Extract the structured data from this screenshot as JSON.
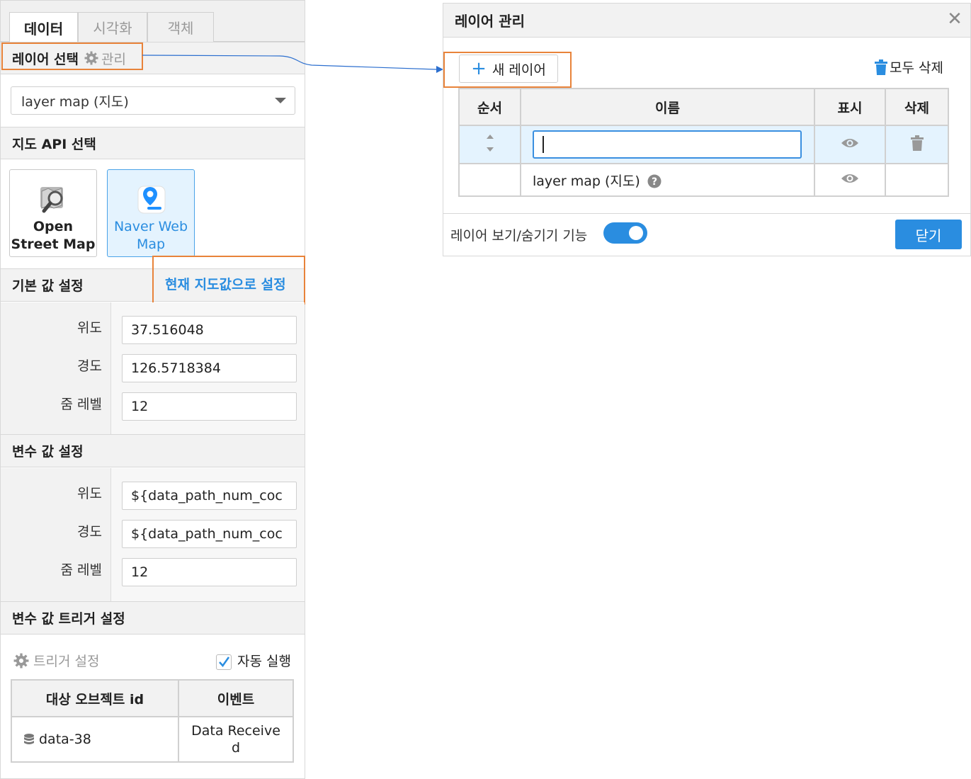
{
  "tabs": [
    {
      "label": "데이터",
      "active": true
    },
    {
      "label": "시각화",
      "active": false
    },
    {
      "label": "객체",
      "active": false
    }
  ],
  "layer_select": {
    "title": "레이어 선택",
    "manage_label": "관리",
    "selected_value": "layer map (지도)"
  },
  "map_api": {
    "title": "지도 API 선택",
    "options": [
      {
        "label": "Open Street Map",
        "icon": "magnifier-map-icon",
        "selected": false
      },
      {
        "label": "Naver Web Map",
        "icon": "naver-map-pin-icon",
        "selected": true
      }
    ]
  },
  "default_values": {
    "title": "기본 값 설정",
    "set_current_label": "현재 지도값으로 설정",
    "rows": [
      {
        "label": "위도",
        "value": "37.516048"
      },
      {
        "label": "경도",
        "value": "126.5718384"
      },
      {
        "label": "줌 레벨",
        "value": "12"
      }
    ]
  },
  "variable_values": {
    "title": "변수 값 설정",
    "rows": [
      {
        "label": "위도",
        "value": "${data_path_num_coc"
      },
      {
        "label": "경도",
        "value": "${data_path_num_coc"
      },
      {
        "label": "줌 레벨",
        "value": "12"
      }
    ]
  },
  "trigger": {
    "title": "변수 값 트리거 설정",
    "settings_label": "트리거 설정",
    "auto_run_label": "자동 실행",
    "auto_run_checked": true,
    "columns": [
      "대상 오브젝트 id",
      "이벤트"
    ],
    "rows": [
      {
        "object_id": "data-38",
        "event": "Data Receive d"
      }
    ]
  },
  "layer_dialog": {
    "title": "레이어 관리",
    "new_layer_label": "새 레이어",
    "delete_all_label": "모두 삭제",
    "columns": [
      "순서",
      "이름",
      "표시",
      "삭제"
    ],
    "rows": [
      {
        "name": "",
        "editing": true,
        "visible": true,
        "deletable": true
      },
      {
        "name": "layer map (지도)",
        "editing": false,
        "visible": true,
        "deletable": false
      }
    ],
    "toggle_label": "레이어 보기/숨기기 기능",
    "toggle_on": true,
    "close_label": "닫기"
  },
  "colors": {
    "accent": "#2a8de0",
    "highlight": "#e8833a",
    "selected_bg": "#e4f3fe"
  }
}
